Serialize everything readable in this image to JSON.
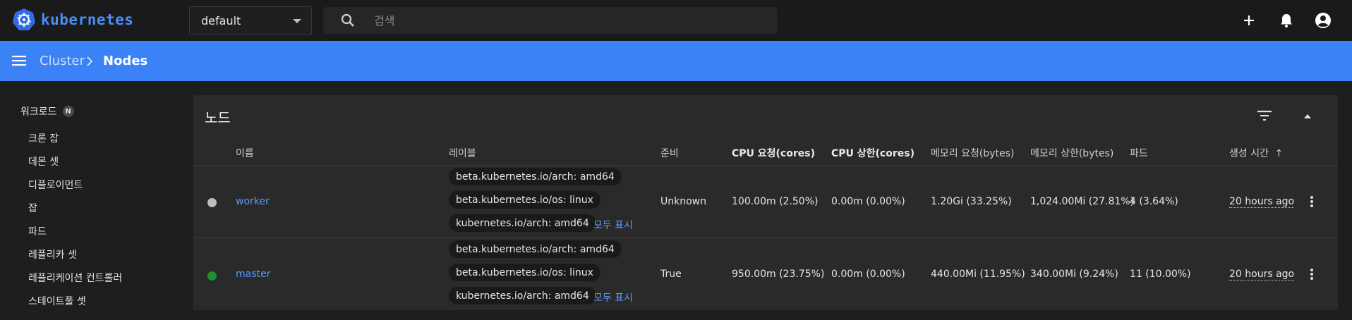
{
  "header": {
    "brand": "kubernetes",
    "namespace": "default",
    "search_placeholder": "검색"
  },
  "breadcrumb": {
    "parent": "Cluster",
    "current": "Nodes"
  },
  "sidebar": {
    "section": "워크로드",
    "section_badge": "N",
    "items": [
      "크론 잡",
      "데몬 셋",
      "디플로이먼트",
      "잡",
      "파드",
      "레플리카 셋",
      "레플리케이션 컨트롤러",
      "스테이트풀 셋"
    ]
  },
  "card": {
    "title": "노드",
    "columns": [
      "이름",
      "레이블",
      "준비",
      "CPU 요청(cores)",
      "CPU 상한(cores)",
      "메모리 요청(bytes)",
      "메모리 상한(bytes)",
      "파드",
      "생성 시간"
    ],
    "sort_arrow": "↑",
    "show_all_label": "모두 표시",
    "rows": [
      {
        "status_color": "#bdbdbd",
        "name": "worker",
        "labels": [
          "beta.kubernetes.io/arch: amd64",
          "beta.kubernetes.io/os: linux",
          "kubernetes.io/arch: amd64"
        ],
        "ready": "Unknown",
        "cpu_requests": "100.00m (2.50%)",
        "cpu_limits": "0.00m (0.00%)",
        "mem_requests": "1.20Gi (33.25%)",
        "mem_limits": "1,024.00Mi (27.81%)",
        "pods": "4 (3.64%)",
        "age": "20 hours ago"
      },
      {
        "status_color": "#1e8e2f",
        "name": "master",
        "labels": [
          "beta.kubernetes.io/arch: amd64",
          "beta.kubernetes.io/os: linux",
          "kubernetes.io/arch: amd64"
        ],
        "ready": "True",
        "cpu_requests": "950.00m (23.75%)",
        "cpu_limits": "0.00m (0.00%)",
        "mem_requests": "440.00Mi (11.95%)",
        "mem_limits": "340.00Mi (9.24%)",
        "pods": "11 (10.00%)",
        "age": "20 hours ago"
      }
    ]
  },
  "colors": {
    "accent": "#3b82f6",
    "link": "#5a9bff",
    "background": "#1e1e1e",
    "card": "#2a2a2a"
  }
}
